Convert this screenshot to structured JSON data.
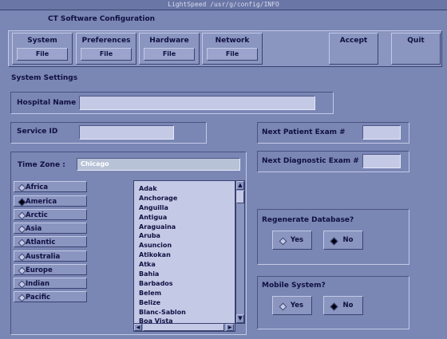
{
  "window": {
    "title": "LightSpeed /usr/g/config/INFO"
  },
  "app": {
    "title": "CT Software Configuration"
  },
  "menu": [
    {
      "label": "System",
      "sub": "File"
    },
    {
      "label": "Preferences",
      "sub": "File"
    },
    {
      "label": "Hardware",
      "sub": "File"
    },
    {
      "label": "Network",
      "sub": "File"
    }
  ],
  "actions": {
    "accept": "Accept",
    "quit": "Quit"
  },
  "section": {
    "title": "System Settings"
  },
  "fields": {
    "hospital_name": {
      "label": "Hospital Name",
      "value": ""
    },
    "service_id": {
      "label": "Service ID",
      "value": ""
    },
    "next_patient_exam": {
      "label": "Next Patient Exam #",
      "value": ""
    },
    "next_diagnostic_exam": {
      "label": "Next Diagnostic Exam #",
      "value": ""
    },
    "time_zone": {
      "label": "Time Zone :",
      "value": "Chicago"
    }
  },
  "regions": [
    {
      "label": "Africa",
      "selected": false
    },
    {
      "label": "America",
      "selected": true
    },
    {
      "label": "Arctic",
      "selected": false
    },
    {
      "label": "Asia",
      "selected": false
    },
    {
      "label": "Atlantic",
      "selected": false
    },
    {
      "label": "Australia",
      "selected": false
    },
    {
      "label": "Europe",
      "selected": false
    },
    {
      "label": "Indian",
      "selected": false
    },
    {
      "label": "Pacific",
      "selected": false
    }
  ],
  "timezones": [
    "Adak",
    "Anchorage",
    "Anguilla",
    "Antigua",
    "Araguaina",
    "Aruba",
    "Asuncion",
    "Atikokan",
    "Atka",
    "Bahia",
    "Barbados",
    "Belem",
    "Belize",
    "Blanc-Sablon",
    "Boa Vista"
  ],
  "regenerate_db": {
    "label": "Regenerate Database?",
    "yes": "Yes",
    "no": "No",
    "selected": "No"
  },
  "mobile_system": {
    "label": "Mobile System?",
    "yes": "Yes",
    "no": "No",
    "selected": "No"
  }
}
